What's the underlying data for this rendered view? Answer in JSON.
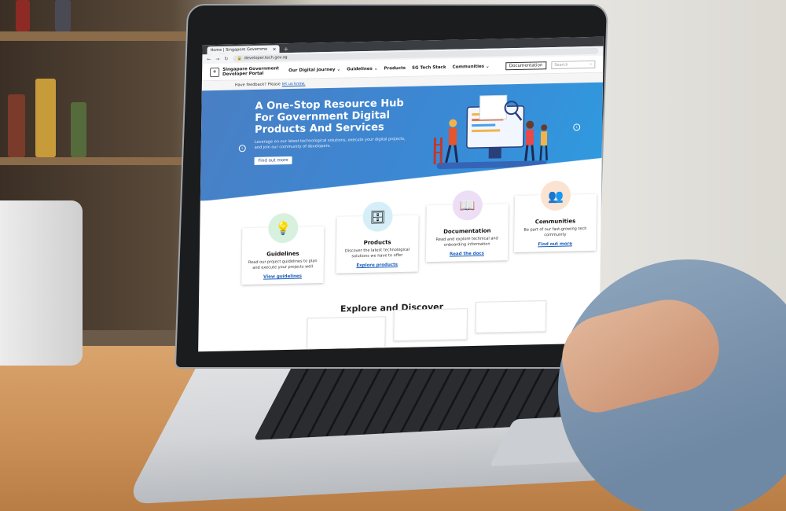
{
  "browser": {
    "tab_title": "Home | Singapore Governme",
    "tab_close": "×",
    "new_tab": "+",
    "url": "developer.tech.gov.sg"
  },
  "nav": {
    "logo_line1": "Singapore Government",
    "logo_line2": "Developer Portal",
    "items": [
      {
        "label": "Our Digital Journey",
        "dropdown": true
      },
      {
        "label": "Guidelines",
        "dropdown": true
      },
      {
        "label": "Products",
        "dropdown": false
      },
      {
        "label": "SG Tech Stack",
        "dropdown": false
      },
      {
        "label": "Communities",
        "dropdown": true
      }
    ],
    "documentation_button": "Documentation",
    "search_placeholder": "Search"
  },
  "feedback": {
    "text": "Have feedback? Please",
    "link": "let us know."
  },
  "hero": {
    "title": "A One-Stop Resource Hub For Government Digital Products And Services",
    "subtitle": "Leverage on our latest technological solutions, execute your digital projects, and join our community of developers.",
    "cta": "Find out more"
  },
  "cards": [
    {
      "title": "Guidelines",
      "desc": "Read our project guidelines to plan and execute your projects well",
      "link": "View guidelines",
      "icon": "lightbulb-icon",
      "color": "#d8f1df"
    },
    {
      "title": "Products",
      "desc": "Discover the latest technological solutions we have to offer",
      "link": "Explore products",
      "icon": "server-icon",
      "color": "#d6eef7"
    },
    {
      "title": "Documentation",
      "desc": "Read and explore technical and onboarding information",
      "link": "Read the docs",
      "icon": "book-icon",
      "color": "#ecdff5"
    },
    {
      "title": "Communities",
      "desc": "Be part of our fast-growing tech community",
      "link": "Find out more",
      "icon": "people-chat-icon",
      "color": "#fbe3d2"
    }
  ],
  "explore_heading": "Explore and Discover"
}
